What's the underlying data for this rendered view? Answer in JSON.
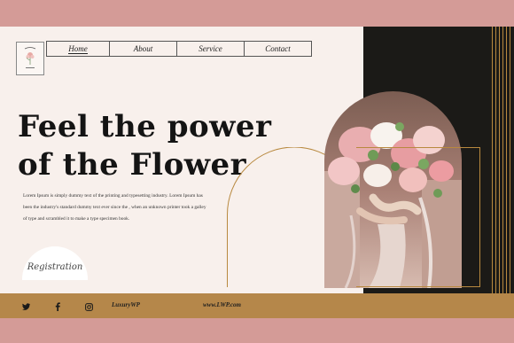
{
  "nav": {
    "items": [
      "Home",
      "About",
      "Service",
      "Contact"
    ]
  },
  "hero": {
    "line1": "Feel the power",
    "line2": "of the Flower"
  },
  "body_text": "Lorem Ipsum is simply dummy text of the printing and typesetting industry. Lorem Ipsum has been the industry's standard dummy text ever since the , when an unknown printer took a galley of type and scrambled it to make a type specimen book.",
  "registration": {
    "label": "Registration"
  },
  "footer": {
    "icons": [
      "twitter-icon",
      "facebook-icon",
      "instagram-icon"
    ],
    "brand": "LuxuryWP",
    "website": "www.LWP.com"
  },
  "colors": {
    "accent_pink": "#d49b97",
    "gold": "#b8893f",
    "footer": "#b5874a",
    "dark": "#1b1a17",
    "background": "#f8f0ec"
  }
}
